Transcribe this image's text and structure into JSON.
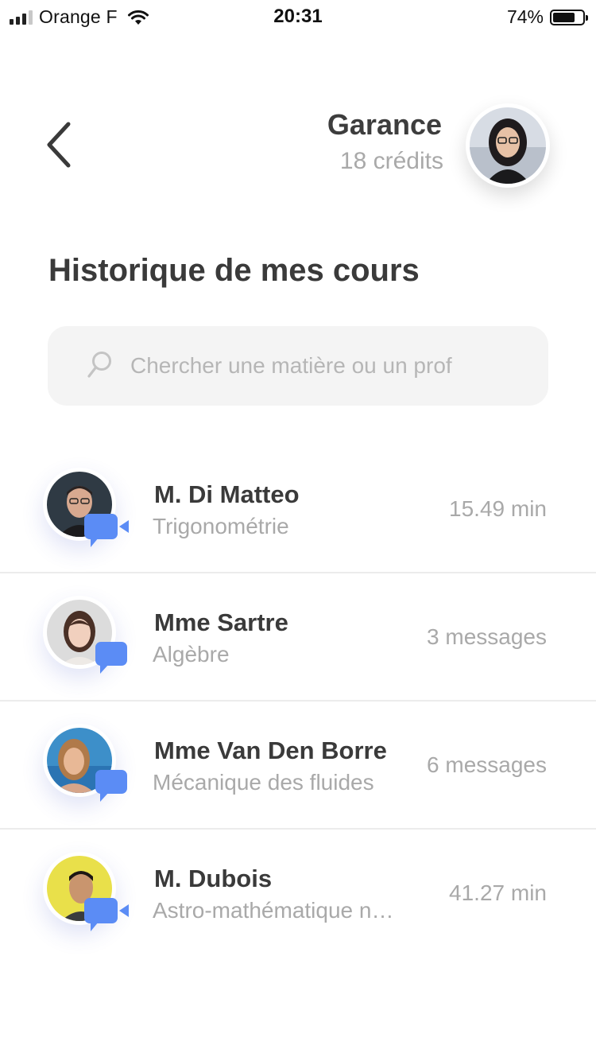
{
  "status_bar": {
    "carrier": "Orange F",
    "time": "20:31",
    "battery_percent": "74%",
    "battery_level": 0.74,
    "signal_bars_active": 3,
    "signal_bars_total": 4
  },
  "header": {
    "back_icon": "chevron-left-icon",
    "profile_name": "Garance",
    "profile_credits": "18 crédits"
  },
  "page_title": "Historique de mes cours",
  "search": {
    "placeholder": "Chercher une matière ou un prof",
    "value": "",
    "icon": "search-icon"
  },
  "courses": [
    {
      "name": "M. Di Matteo",
      "subject": "Trigonométrie",
      "meta": "15.49 min",
      "type": "video",
      "icon": "video-chat-icon"
    },
    {
      "name": "Mme Sartre",
      "subject": "Algèbre",
      "meta": "3 messages",
      "type": "message",
      "icon": "chat-bubble-icon"
    },
    {
      "name": "Mme Van Den Borre",
      "subject": "Mécanique des fluides",
      "meta": "6 messages",
      "type": "message",
      "icon": "chat-bubble-icon"
    },
    {
      "name": "M. Dubois",
      "subject": "Astro-mathématique n…",
      "meta": "41.27 min",
      "type": "video",
      "icon": "video-chat-icon"
    }
  ],
  "colors": {
    "accent": "#5b8cf5",
    "title": "#3a3a3a",
    "muted": "#a9a9a9",
    "search_bg": "#f4f4f4",
    "divider": "#ececec"
  }
}
